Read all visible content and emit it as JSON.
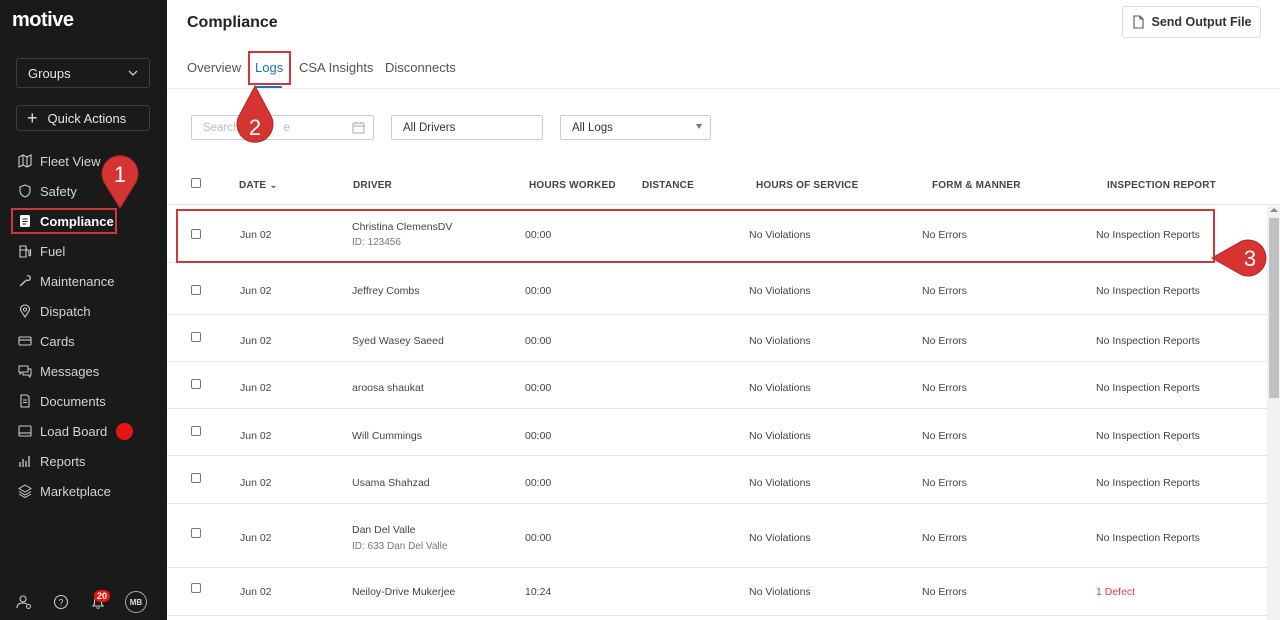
{
  "sidebar": {
    "logo": "motive",
    "groups_label": "Groups",
    "quick_actions_label": "Quick Actions",
    "nav": [
      {
        "label": "Fleet View",
        "icon": "map-icon"
      },
      {
        "label": "Safety",
        "icon": "shield-icon"
      },
      {
        "label": "Compliance",
        "icon": "document-icon",
        "active": true
      },
      {
        "label": "Fuel",
        "icon": "fuel-icon"
      },
      {
        "label": "Maintenance",
        "icon": "wrench-icon"
      },
      {
        "label": "Dispatch",
        "icon": "pin-icon"
      },
      {
        "label": "Cards",
        "icon": "card-icon"
      },
      {
        "label": "Messages",
        "icon": "chat-icon"
      },
      {
        "label": "Documents",
        "icon": "file-icon"
      },
      {
        "label": "Load Board",
        "icon": "truck-icon",
        "badge": true
      },
      {
        "label": "Reports",
        "icon": "chart-icon"
      },
      {
        "label": "Marketplace",
        "icon": "layers-icon"
      }
    ],
    "notification_count": "20",
    "avatar_initials": "MB"
  },
  "header": {
    "title": "Compliance",
    "send_button_label": "Send Output File"
  },
  "tabs": [
    {
      "label": "Overview"
    },
    {
      "label": "Logs",
      "active": true
    },
    {
      "label": "CSA Insights"
    },
    {
      "label": "Disconnects"
    }
  ],
  "filters": {
    "search_placeholder": "Search",
    "search_tail": "e",
    "drivers_value": "All Drivers",
    "logs_value": "All Logs"
  },
  "table": {
    "columns": {
      "date": "DATE",
      "driver": "DRIVER",
      "hours_worked": "HOURS WORKED",
      "distance": "DISTANCE",
      "hours_of_service": "HOURS OF SERVICE",
      "form_manner": "FORM & MANNER",
      "inspection_report": "INSPECTION REPORT"
    },
    "rows": [
      {
        "date": "Jun 02",
        "driver": "Christina ClemensDV",
        "driver_id": "ID: 123456",
        "hours": "00:00",
        "distance": "",
        "hos": "No Violations",
        "form": "No Errors",
        "inspection": "No Inspection Reports"
      },
      {
        "date": "Jun 02",
        "driver": "Jeffrey Combs",
        "driver_id": "",
        "hours": "00:00",
        "distance": "",
        "hos": "No Violations",
        "form": "No Errors",
        "inspection": "No Inspection Reports"
      },
      {
        "date": "Jun 02",
        "driver": "Syed Wasey Saeed",
        "driver_id": "",
        "hours": "00:00",
        "distance": "",
        "hos": "No Violations",
        "form": "No Errors",
        "inspection": "No Inspection Reports"
      },
      {
        "date": "Jun 02",
        "driver": "aroosa shaukat",
        "driver_id": "",
        "hours": "00:00",
        "distance": "",
        "hos": "No Violations",
        "form": "No Errors",
        "inspection": "No Inspection Reports"
      },
      {
        "date": "Jun 02",
        "driver": "Will Cummings",
        "driver_id": "",
        "hours": "00:00",
        "distance": "",
        "hos": "No Violations",
        "form": "No Errors",
        "inspection": "No Inspection Reports"
      },
      {
        "date": "Jun 02",
        "driver": "Usama Shahzad",
        "driver_id": "",
        "hours": "00:00",
        "distance": "",
        "hos": "No Violations",
        "form": "No Errors",
        "inspection": "No Inspection Reports"
      },
      {
        "date": "Jun 02",
        "driver": "Dan Del Valle",
        "driver_id": "ID: 633 Dan Del Valle",
        "hours": "00:00",
        "distance": "",
        "hos": "No Violations",
        "form": "No Errors",
        "inspection": "No Inspection Reports"
      },
      {
        "date": "Jun 02",
        "driver": "Neiloy-Drive Mukerjee",
        "driver_id": "",
        "hours": "10:24",
        "distance": "",
        "hos": "No Violations",
        "form": "No Errors",
        "inspection": "1 Defect",
        "inspection_defect": true
      }
    ]
  },
  "callouts": [
    "1",
    "2",
    "3"
  ],
  "colors": {
    "accent": "#1a73c7",
    "annotation": "#d03838",
    "sidebar_bg": "#1a1a1a",
    "defect": "#e34040"
  }
}
